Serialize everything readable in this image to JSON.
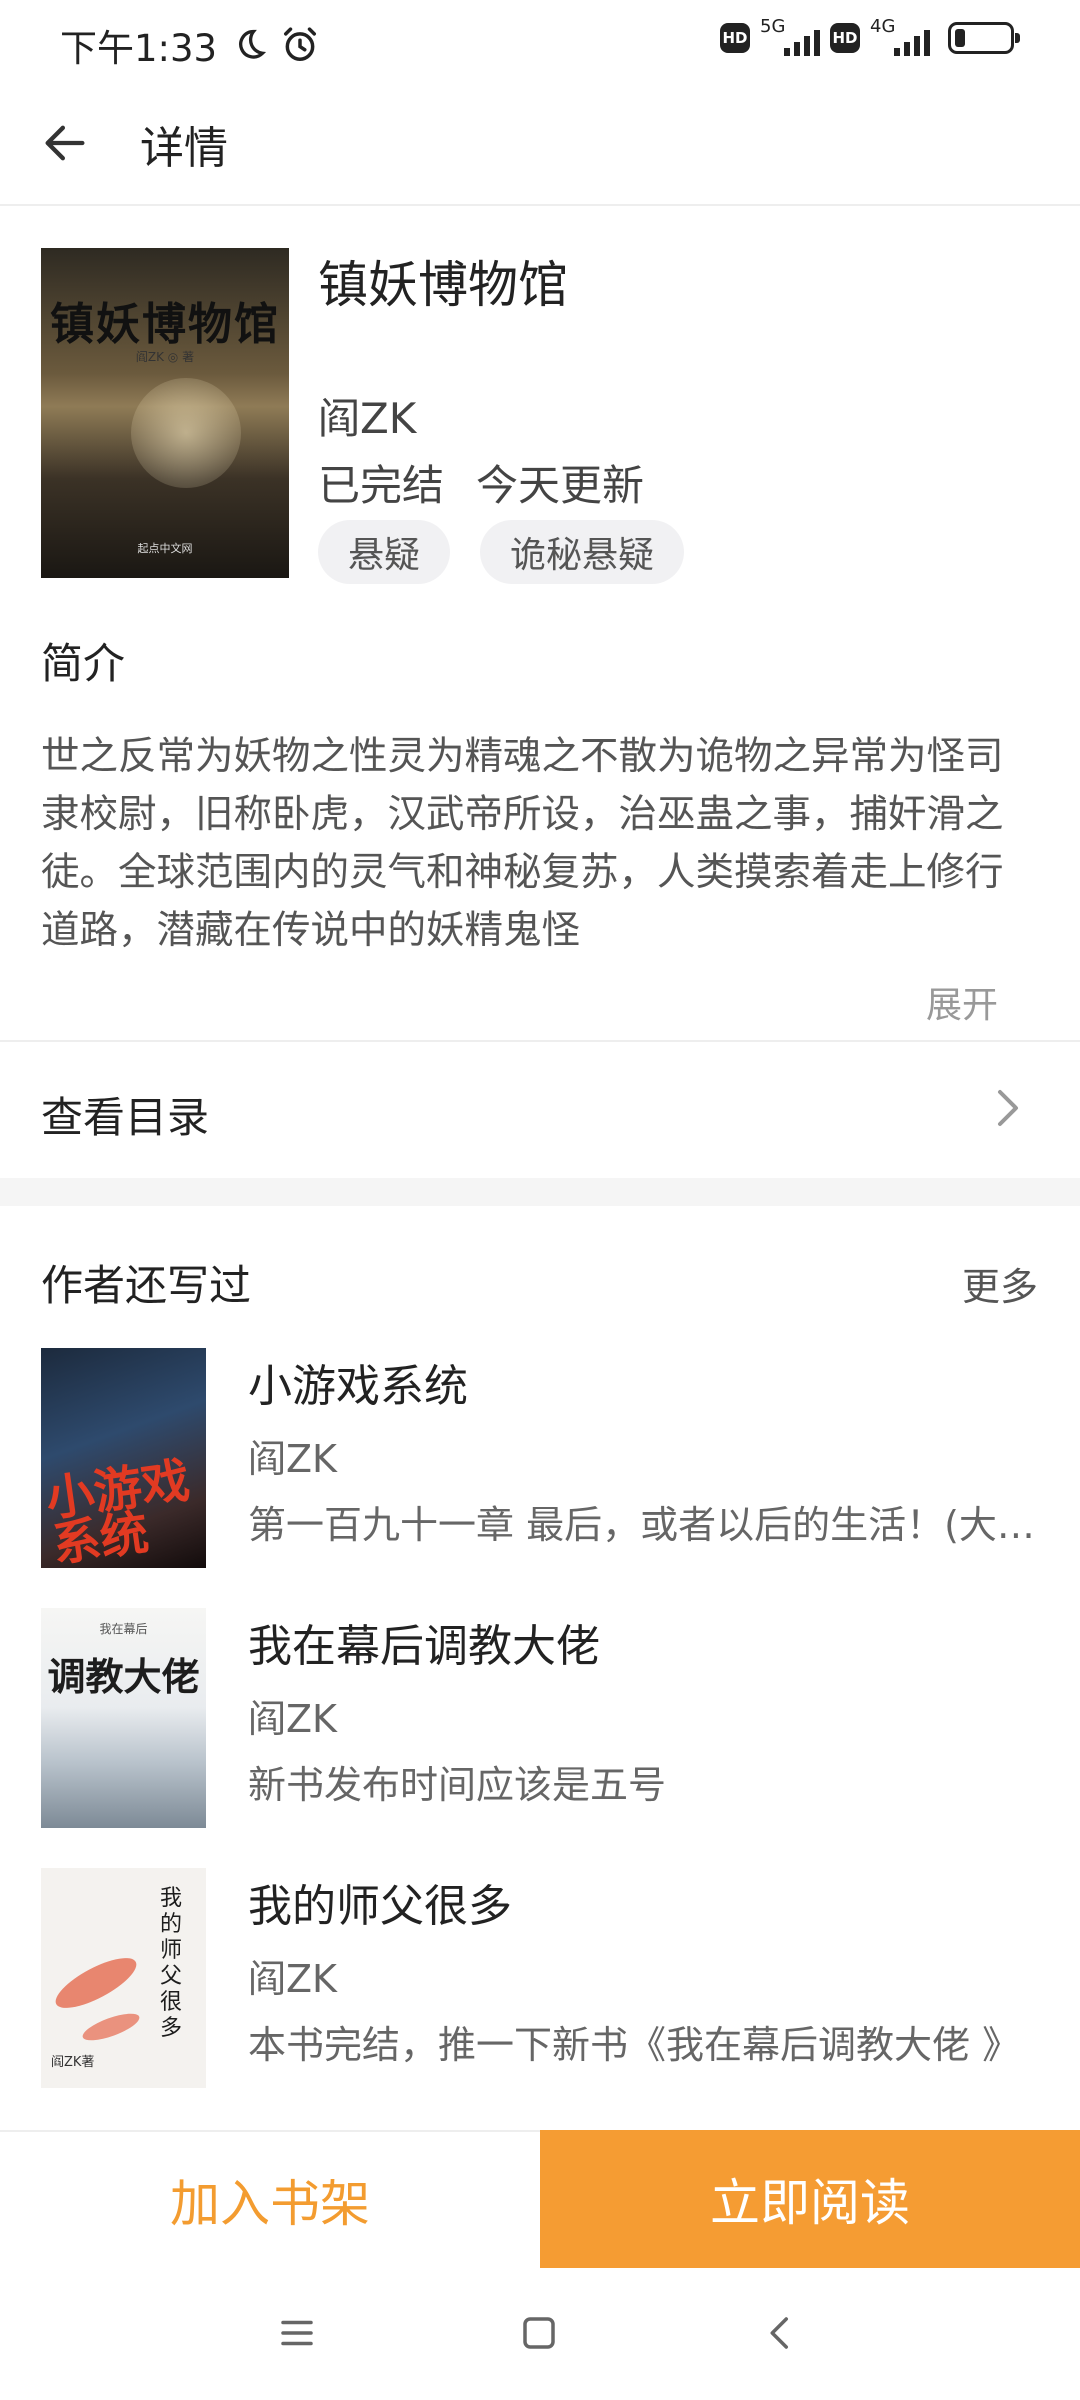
{
  "status_bar": {
    "time": "下午1:33",
    "hd1": "HD",
    "net1": "5G",
    "hd2": "HD",
    "net2": "4G",
    "battery_level": 0.2
  },
  "header": {
    "title": "详情"
  },
  "book": {
    "title": "镇妖博物馆",
    "author": "阎ZK",
    "status": "已完结",
    "update": "今天更新",
    "tags": [
      "悬疑",
      "诡秘悬疑"
    ],
    "cover_title": "镇妖博物馆",
    "cover_author": "阎ZK ◎ 著",
    "cover_publisher": "起点中文网"
  },
  "intro": {
    "heading": "简介",
    "text": "世之反常为妖物之性灵为精魂之不散为诡物之异常为怪司隶校尉，旧称卧虎，汉武帝所设，治巫蛊之事，捕奸滑之徒。全球范围内的灵气和神秘复苏，人类摸索着走上修行道路，潜藏在传说中的妖精鬼怪",
    "expand_label": "展开"
  },
  "toc": {
    "label": "查看目录"
  },
  "also_by_author": {
    "heading": "作者还写过",
    "more_label": "更多",
    "books": [
      {
        "title": "小游戏系统",
        "author": "阎ZK",
        "latest": "第一百九十一章 最后，或者以后的生活！(大结局)",
        "cover_text": "小游戏系统"
      },
      {
        "title": "我在幕后调教大佬",
        "author": "阎ZK",
        "latest": "新书发布时间应该是五号",
        "cover_text": "调教大佬",
        "cover_sub": "我在幕后"
      },
      {
        "title": "我的师父很多",
        "author": "阎ZK",
        "latest": "本书完结，推一下新书《我在幕后调教大佬 》",
        "cover_text": "我的师父很多",
        "cover_author": "阎ZK著"
      }
    ]
  },
  "actions": {
    "add_shelf": "加入书架",
    "read_now": "立即阅读"
  },
  "colors": {
    "accent": "#f59c33",
    "shelf_text": "#f39c30"
  }
}
